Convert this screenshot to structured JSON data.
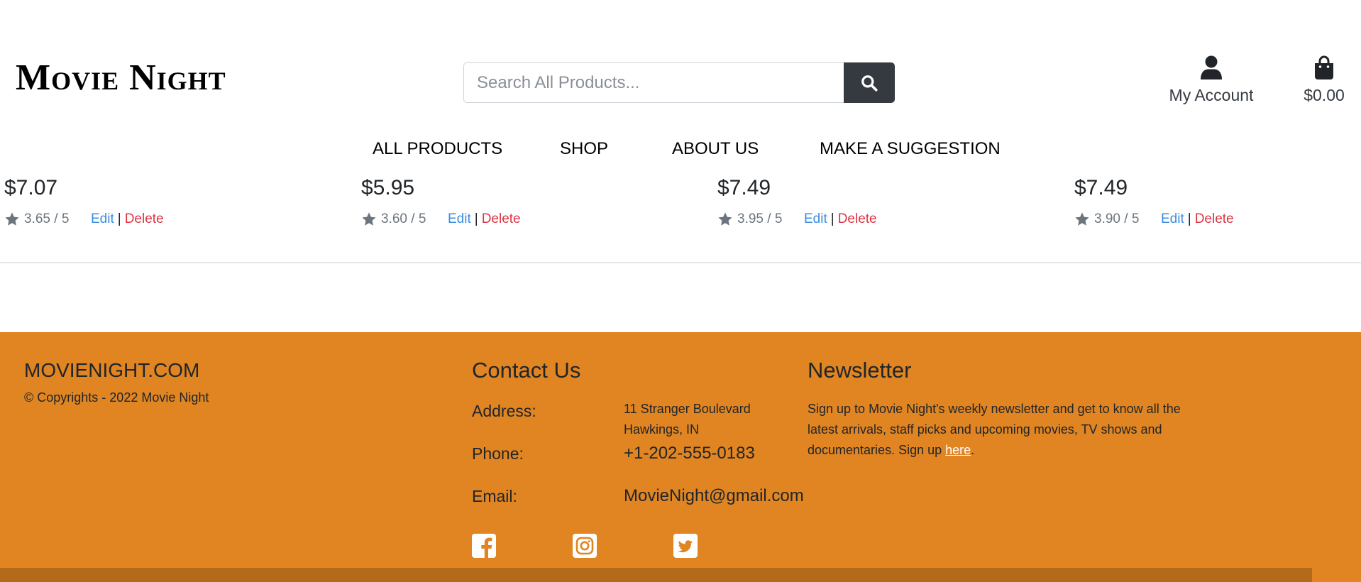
{
  "header": {
    "logo": "Movie Night",
    "search": {
      "placeholder": "Search All Products..."
    },
    "account_label": "My Account",
    "bag_total": "$0.00"
  },
  "nav": {
    "items": [
      {
        "label": "ALL PRODUCTS"
      },
      {
        "label": "SHOP"
      },
      {
        "label": "ABOUT US"
      },
      {
        "label": "MAKE A SUGGESTION"
      }
    ]
  },
  "products": [
    {
      "price": "$7.07",
      "rating": "3.65 / 5",
      "edit": "Edit",
      "separator": "|",
      "delete": "Delete"
    },
    {
      "price": "$5.95",
      "rating": "3.60 / 5",
      "edit": "Edit",
      "separator": "|",
      "delete": "Delete"
    },
    {
      "price": "$7.49",
      "rating": "3.95 / 5",
      "edit": "Edit",
      "separator": "|",
      "delete": "Delete"
    },
    {
      "price": "$7.49",
      "rating": "3.90 / 5",
      "edit": "Edit",
      "separator": "|",
      "delete": "Delete"
    }
  ],
  "footer": {
    "brand": "MOVIENIGHT.COM",
    "copyright": "© Copyrights - 2022 Movie Night",
    "contact": {
      "title": "Contact Us",
      "address_label": "Address:",
      "address_line1": "11 Stranger Boulevard",
      "address_line2": "Hawkings, IN",
      "phone_label": "Phone:",
      "phone": "+1-202-555-0183",
      "email_label": "Email:",
      "email": "MovieNight@gmail.com"
    },
    "newsletter": {
      "title": "Newsletter",
      "text": "Sign up to Movie Night's weekly newsletter and get to know all the latest arrivals, staff picks and upcoming movies, TV shows and documentaries. Sign up ",
      "link": "here",
      "tail": "."
    },
    "social": [
      "facebook-icon",
      "instagram-icon",
      "twitter-icon"
    ]
  },
  "colors": {
    "footer_bg": "#e08522",
    "footer_bar": "#b36a1b",
    "edit_link": "#3b8ce0",
    "delete_link": "#dc3545",
    "search_button": "#343a40"
  }
}
